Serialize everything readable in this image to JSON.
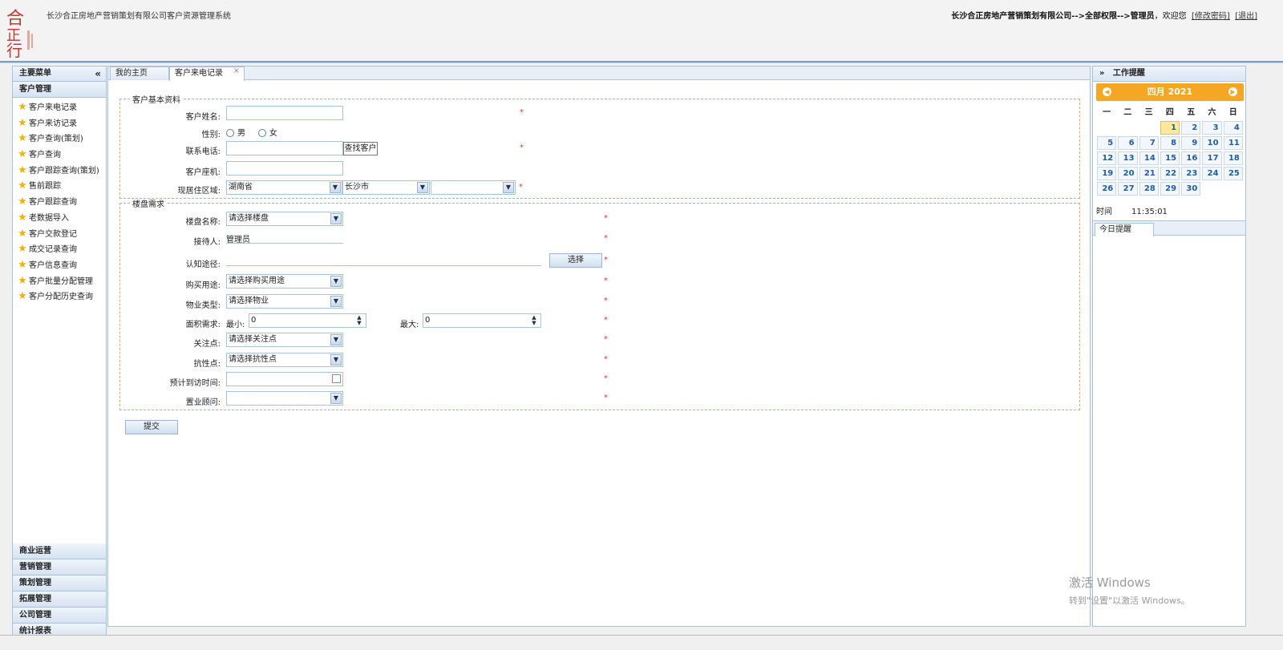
{
  "header": {
    "system_title": "长沙合正房地产营销策划有限公司客户资源管理系统",
    "path": "长沙合正房地产营销策划有限公司-->全部权限-->管理员",
    "welcome": "，欢迎您",
    "change_password": "[修改密码]",
    "logout": "[退出]"
  },
  "left_menu": {
    "title": "主要菜单",
    "collapse_icon": "«",
    "active_group": "客户管理",
    "items": [
      "客户来电记录",
      "客户来访记录",
      "客户查询(策划)",
      "客户查询",
      "客户跟踪查询(策划)",
      "售前跟踪",
      "客户跟踪查询",
      "老数据导入",
      "客户交款登记",
      "成交记录查询",
      "客户信息查询",
      "客户批量分配管理",
      "客户分配历史查询"
    ],
    "groups": [
      "商业运营",
      "营销管理",
      "策划管理",
      "拓展管理",
      "公司管理",
      "统计报表"
    ]
  },
  "tabs": [
    {
      "label": "我的主页"
    },
    {
      "label": "客户来电记录",
      "close": "×"
    }
  ],
  "form": {
    "basic_legend": "客户基本资料",
    "name_label": "客户姓名:",
    "gender_label": "性别:",
    "gender_male": "男",
    "gender_female": "女",
    "phone_label": "联系电话:",
    "find_customer": "查找客户",
    "landline_label": "客户座机:",
    "region_label": "现居住区域:",
    "province": "湖南省",
    "city": "长沙市",
    "district": "",
    "demand_legend": "楼盘需求",
    "building_label": "楼盘名称:",
    "building_value": "请选择楼盘",
    "receptionist_label": "接待人:",
    "receptionist_value": "管理员",
    "channel_label": "认知途径:",
    "choose_button": "选择",
    "purpose_label": "购买用途:",
    "purpose_value": "请选择购买用途",
    "property_label": "物业类型:",
    "property_value": "请选择物业",
    "area_label": "面积需求:",
    "area_min_label": "最小:",
    "area_min": "0",
    "area_max_label": "最大:",
    "area_max": "0",
    "focus_label": "关注点:",
    "focus_value": "请选择关注点",
    "resist_label": "抗性点:",
    "resist_value": "请选择抗性点",
    "visit_time_label": "预计到访时间:",
    "consultant_label": "置业顾问:",
    "submit": "提交",
    "required_mark": "*"
  },
  "right_panel": {
    "expand_icon": "»",
    "title": "工作提醒",
    "calendar": {
      "month_label": "四月 2021",
      "weekdays": [
        "一",
        "二",
        "三",
        "四",
        "五",
        "六",
        "日"
      ],
      "weeks": [
        [
          "",
          "",
          "",
          "1",
          "2",
          "3",
          "4"
        ],
        [
          "5",
          "6",
          "7",
          "8",
          "9",
          "10",
          "11"
        ],
        [
          "12",
          "13",
          "14",
          "15",
          "16",
          "17",
          "18"
        ],
        [
          "19",
          "20",
          "21",
          "22",
          "23",
          "24",
          "25"
        ],
        [
          "26",
          "27",
          "28",
          "29",
          "30",
          "",
          ""
        ]
      ],
      "today": "1",
      "time_label": "时间",
      "time_value": "11:35:01"
    },
    "today_reminder_tab": "今日提醒"
  },
  "watermark": {
    "line1": "激活 Windows",
    "line2": "转到\"设置\"以激活 Windows。"
  },
  "colors": {
    "calendar_header": "#f5a623",
    "required": "#ee3333",
    "fieldset_border": "#f2a060",
    "panel_border": "#aac3dc"
  }
}
